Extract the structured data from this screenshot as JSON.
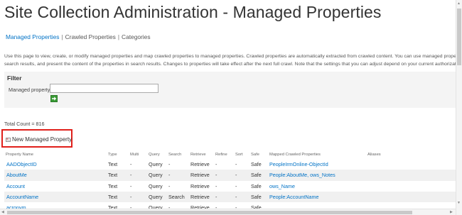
{
  "header": {
    "title": "Site Collection Administration - Managed Properties"
  },
  "tabs": [
    {
      "label": "Managed Properties",
      "current": false
    },
    {
      "label": "Crawled Properties",
      "current": true
    },
    {
      "label": "Categories",
      "current": true
    }
  ],
  "tabs_separator": "|",
  "description": [
    "Use this page to view, create, or modify managed properties and map crawled properties to managed properties. Crawled properties are automatically extracted from crawled content. You can use managed properties to",
    "search results, and present the content of the properties in search results. Changes to properties will take effect after the next full crawl. Note that the settings that you can adjust depend on your current authorization lev"
  ],
  "filter": {
    "title": "Filter",
    "field_label": "Managed property",
    "value": "",
    "go_icon": "go-arrow-icon"
  },
  "total_count": "Total Count = 816",
  "new_property": {
    "label": "New Managed Property",
    "icon": "new-document-icon"
  },
  "table": {
    "columns": [
      "Property Name",
      "Type",
      "Multi",
      "Query",
      "Search",
      "Retrieve",
      "Refine",
      "Sort",
      "Safe",
      "Mapped Crawled Properties",
      "Aliases"
    ],
    "rows": [
      {
        "name": "AADObjectID",
        "type": "Text",
        "multi": "-",
        "query": "Query",
        "search": "-",
        "retrieve": "Retrieve",
        "refine": "-",
        "sort": "-",
        "safe": "Safe",
        "mapped": "PeopleIrmOnline-ObjectId",
        "aliases": ""
      },
      {
        "name": "AboutMe",
        "type": "Text",
        "multi": "-",
        "query": "Query",
        "search": "-",
        "retrieve": "Retrieve",
        "refine": "-",
        "sort": "-",
        "safe": "Safe",
        "mapped": "People:AboutMe, ows_Notes",
        "aliases": ""
      },
      {
        "name": "Account",
        "type": "Text",
        "multi": "-",
        "query": "Query",
        "search": "-",
        "retrieve": "Retrieve",
        "refine": "-",
        "sort": "-",
        "safe": "Safe",
        "mapped": "ows_Name",
        "aliases": ""
      },
      {
        "name": "AccountName",
        "type": "Text",
        "multi": "-",
        "query": "Query",
        "search": "Search",
        "retrieve": "Retrieve",
        "refine": "-",
        "sort": "-",
        "safe": "Safe",
        "mapped": "People:AccountName",
        "aliases": ""
      },
      {
        "name": "acronym",
        "type": "Text",
        "multi": "-",
        "query": "Query",
        "search": "-",
        "retrieve": "Retrieve",
        "refine": "-",
        "sort": "-",
        "safe": "Safe",
        "mapped": "",
        "aliases": ""
      }
    ]
  },
  "colors": {
    "link": "#0072c6",
    "title": "#333333",
    "highlight_border": "#e0201b",
    "go_button": "#3a9b36",
    "alt_row": "#f0f0f0",
    "filter_background": "#f4f4f4"
  }
}
